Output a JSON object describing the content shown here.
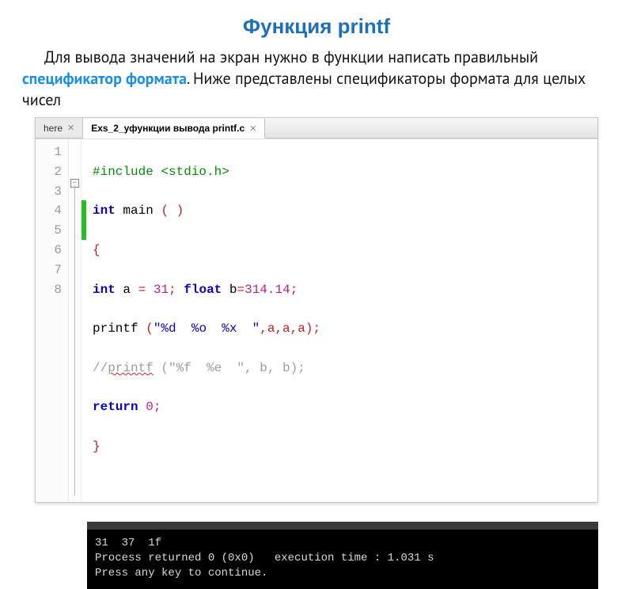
{
  "title": "Функция printf",
  "paragraph": {
    "t1": "Для вывода значений на экран нужно в функции написать правильный ",
    "hl": "спецификатор формата",
    "t2": ". Ниже представлены спецификаторы формата для целых чисел"
  },
  "tabs": {
    "inactive": {
      "label": "here"
    },
    "active": {
      "label": "Exs_2_уфункции вывода printf.c"
    }
  },
  "gutter": [
    "1",
    "2",
    "3",
    "4",
    "5",
    "6",
    "7",
    "8"
  ],
  "foldSymbol": "−",
  "code": {
    "l1": {
      "directive": "#include",
      "header": "<stdio.h>"
    },
    "l2": {
      "kw1": "int",
      "fn": "main",
      "parens": "( )"
    },
    "l3": {
      "brace": "{"
    },
    "l4": {
      "kw1": "int",
      "v1": " a ",
      "eq1": "=",
      "sp1": " ",
      "n1": "31",
      "semi1": ";",
      "sp2": " ",
      "kw2": "float",
      "v2": " b",
      "eq2": "=",
      "n2": "314.14",
      "semi2": ";"
    },
    "l5": {
      "fnc": "printf",
      "sp": " ",
      "op": "(",
      "str": "\"%d  %o  %x  \"",
      "args": ",a,a,a",
      "cp": ")",
      "semi": ";"
    },
    "l6": {
      "comment_a": "//",
      "comment_b": "printf",
      "comment_c": " (\"%f  %e  \", b, b);"
    },
    "l7": {
      "kw": "return",
      "sp": " ",
      "n": "0",
      "semi": ";"
    },
    "l8": {
      "brace": "}"
    }
  },
  "console": {
    "l1": "31  37  1f",
    "l2": "Process returned 0 (0x0)   execution time : 1.031 s",
    "l3": "Press any key to continue."
  }
}
